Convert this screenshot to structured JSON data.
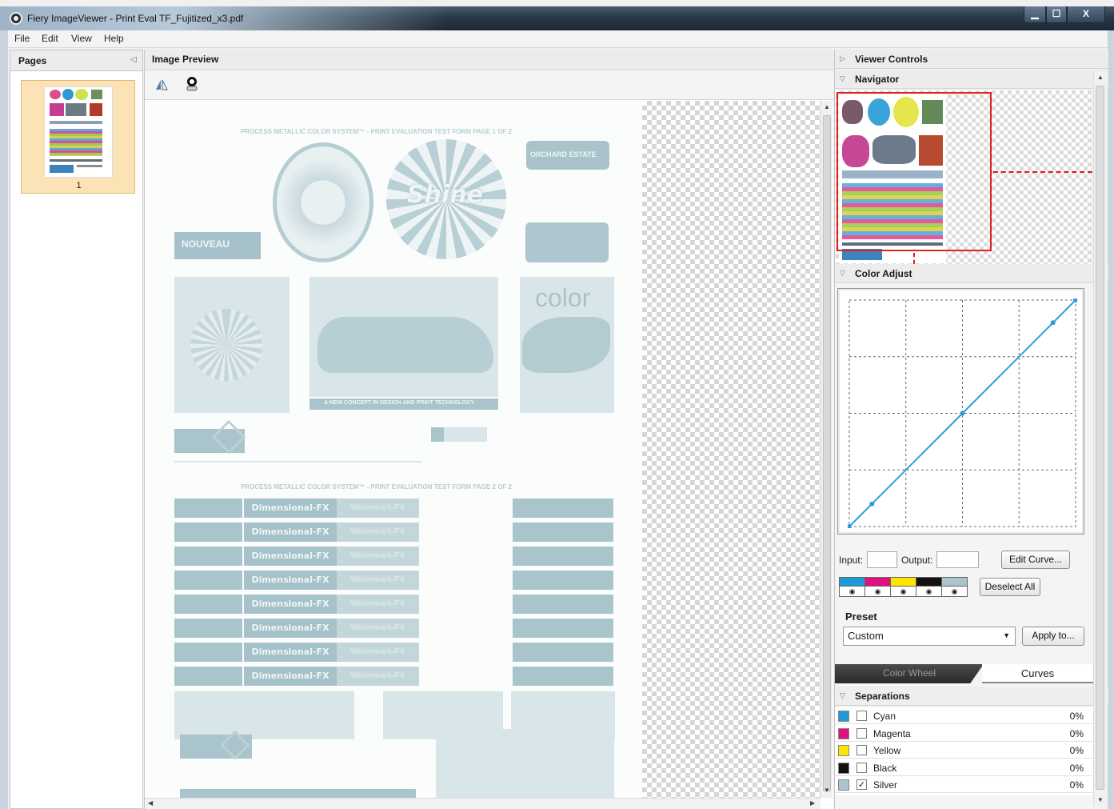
{
  "window": {
    "title": "Fiery ImageViewer - Print Eval TF_Fujitized_x3.pdf",
    "controls": {
      "minimize": "▁",
      "maximize": "☐",
      "close": "X"
    }
  },
  "menu": [
    "File",
    "Edit",
    "View",
    "Help"
  ],
  "pages_panel": {
    "title": "Pages",
    "pages": [
      {
        "number": "1"
      }
    ]
  },
  "preview": {
    "title": "Image Preview",
    "tools": [
      {
        "name": "split-view-tool"
      },
      {
        "name": "loupe-tool"
      }
    ],
    "document": {
      "heading_page1": "PROCESS METALLIC COLOR SYSTEM™ - PRINT EVALUATION TEST FORM    PAGE 1 OF 2",
      "heading_page2": "PROCESS METALLIC COLOR SYSTEM™ - PRINT EVALUATION TEST FORM    PAGE 2 OF 2",
      "label_shine": "Shine",
      "label_orchard": "ORCHARD ESTATE",
      "label_nouveau": "NOUVEAU",
      "label_color": "color",
      "label_concept": "A NEW CONCEPT IN DESIGN AND PRINT TECHNOLOGY",
      "fx_label": "Dimensional-FX",
      "watermark_label": "Watermark-FX",
      "fx_rows": 8
    }
  },
  "viewer_controls": {
    "title": "Viewer Controls",
    "navigator": {
      "title": "Navigator"
    },
    "color_adjust": {
      "title": "Color Adjust",
      "curve_points": [
        [
          0,
          0
        ],
        [
          10,
          10
        ],
        [
          50,
          50
        ],
        [
          90,
          90
        ],
        [
          100,
          100
        ]
      ],
      "input_label": "Input:",
      "input_value": "",
      "output_label": "Output:",
      "output_value": "",
      "edit_curve_button": "Edit Curve...",
      "deselect_all_button": "Deselect All",
      "channels": [
        {
          "name": "cyan",
          "color": "#1f9ad6"
        },
        {
          "name": "magenta",
          "color": "#e0107f"
        },
        {
          "name": "yellow",
          "color": "#ffe500"
        },
        {
          "name": "black",
          "color": "#111111"
        },
        {
          "name": "silver",
          "color": "#a9c4cb"
        }
      ],
      "preset_label": "Preset",
      "preset_value": "Custom",
      "apply_button": "Apply to...",
      "tabs": {
        "color_wheel": "Color Wheel",
        "curves": "Curves"
      }
    },
    "separations": {
      "title": "Separations",
      "items": [
        {
          "name": "Cyan",
          "color": "#1f9ad6",
          "checked": false,
          "percent": "0%"
        },
        {
          "name": "Magenta",
          "color": "#e0107f",
          "checked": false,
          "percent": "0%"
        },
        {
          "name": "Yellow",
          "color": "#ffe500",
          "checked": false,
          "percent": "0%"
        },
        {
          "name": "Black",
          "color": "#111111",
          "checked": false,
          "percent": "0%"
        },
        {
          "name": "Silver",
          "color": "#a9c4cb",
          "checked": true,
          "percent": "0%"
        }
      ]
    }
  },
  "colors": {
    "accent_curve": "#2a9fd6",
    "navigator_frame": "#e02020",
    "selected_page": "#fbe3b5"
  }
}
